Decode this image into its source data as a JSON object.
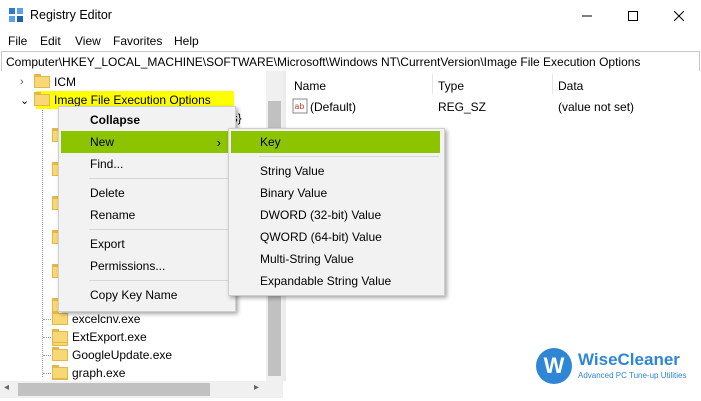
{
  "window": {
    "title": "Registry Editor"
  },
  "menubar": [
    "File",
    "Edit",
    "View",
    "Favorites",
    "Help"
  ],
  "address": "Computer\\HKEY_LOCAL_MACHINE\\SOFTWARE\\Microsoft\\Windows NT\\CurrentVersion\\Image File Execution Options",
  "tree": {
    "icm": "ICM",
    "ifeo": "Image File Execution Options",
    "partial_child": "gs}",
    "children": [
      "excelcnv.exe",
      "ExtExport.exe",
      "GoogleUpdate.exe",
      "graph.exe"
    ]
  },
  "values_pane": {
    "columns": [
      "Name",
      "Type",
      "Data"
    ],
    "rows": [
      {
        "name": "(Default)",
        "type": "REG_SZ",
        "data": "(value not set)"
      }
    ]
  },
  "context_menu": {
    "items": [
      "Collapse",
      "New",
      "Find...",
      "Delete",
      "Rename",
      "Export",
      "Permissions...",
      "Copy Key Name"
    ],
    "submenu_arrow": "›"
  },
  "new_submenu": {
    "items": [
      "Key",
      "String Value",
      "Binary Value",
      "DWORD (32-bit) Value",
      "QWORD (64-bit) Value",
      "Multi-String Value",
      "Expandable String Value"
    ]
  },
  "watermark": {
    "brand": "WiseCleaner",
    "tagline": "Advanced PC Tune-up Utilities",
    "logo_letter": "W"
  },
  "colors": {
    "highlight_yellow": "#ffff00",
    "menu_highlight_green": "#8cc400",
    "folder": "#f8d775"
  }
}
